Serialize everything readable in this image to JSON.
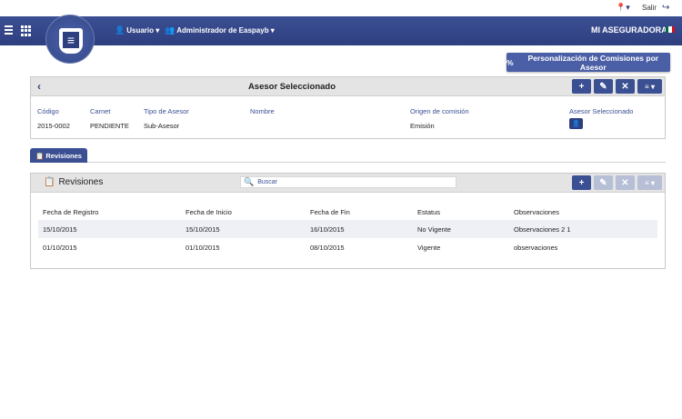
{
  "util": {
    "user_menu_icon": "pin-icon",
    "salir": "Salir",
    "logout_icon": "logout-icon"
  },
  "header": {
    "usuario": "Usuario",
    "administrador": "Administrador de Easpayb",
    "company": "MI ASEGURADORA",
    "flag_colors": [
      "#006847",
      "#ffffff",
      "#ce1126"
    ]
  },
  "personalization_button": "Personalización de Comisiones por Asesor",
  "asesor_panel": {
    "title": "Asesor Seleccionado",
    "fields": [
      {
        "label": "Código",
        "value": "2015-0002"
      },
      {
        "label": "Carnet",
        "value": "PENDIENTE"
      },
      {
        "label": "Tipo de Asesor",
        "value": "Sub-Asesor"
      },
      {
        "label": "Nombre",
        "value": ""
      },
      {
        "label": "Origen de comisión",
        "value": "Emisión"
      },
      {
        "label": "Asesor Seleccionado",
        "value": ""
      }
    ]
  },
  "tabs": [
    {
      "label": "Revisiones",
      "active": true
    }
  ],
  "revisiones": {
    "title": "Revisiones",
    "search_placeholder": "Buscar",
    "columns": [
      "Fecha de Registro",
      "Fecha de Inicio",
      "Fecha de Fin",
      "Estatus",
      "Observaciones"
    ],
    "rows": [
      [
        "15/10/2015",
        "15/10/2015",
        "16/10/2015",
        "No Vigente",
        "Observaciones 2 1"
      ],
      [
        "01/10/2015",
        "01/10/2015",
        "08/10/2015",
        "Vigente",
        "observaciones"
      ]
    ]
  },
  "colors": {
    "primary": "#3b4f93",
    "header_bg": "#2e3f80",
    "panel_head": "#e4e4e4"
  }
}
